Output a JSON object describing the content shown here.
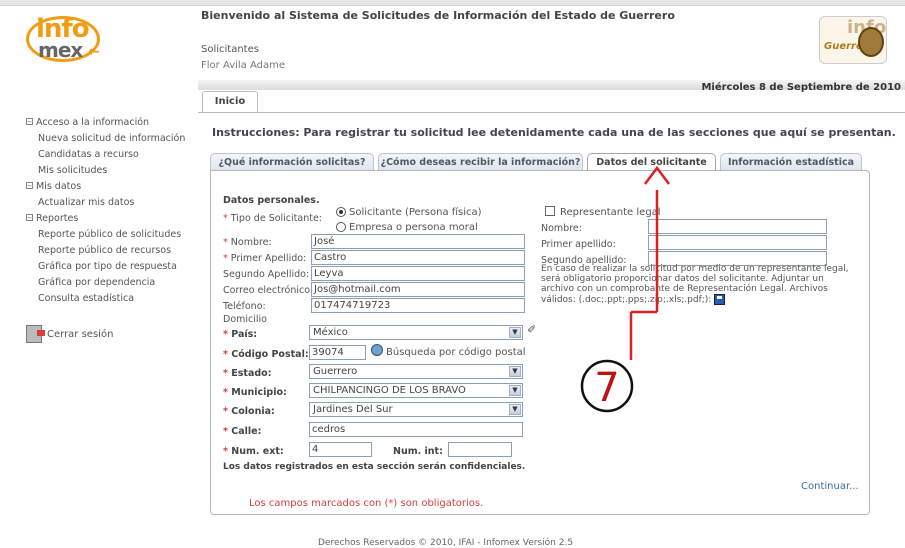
{
  "header": {
    "logo_left_text": [
      "info",
      "mex"
    ],
    "title": "Bienvenido al Sistema de Solicitudes de Información del Estado de Guerrero",
    "role": "Solicitantes",
    "user": "Flor Avila Adame",
    "logo_right_text": [
      "info",
      "Guerrero"
    ],
    "date": "Miércoles 8 de Septiembre de 2010"
  },
  "tabs_top": {
    "inicio": "Inicio"
  },
  "sidebar": {
    "items": [
      {
        "label": "Acceso a la información",
        "type": "section"
      },
      {
        "label": "Nueva solicitud de información",
        "type": "item"
      },
      {
        "label": "Candidatas a recurso",
        "type": "item"
      },
      {
        "label": "Mis solicitudes",
        "type": "item"
      },
      {
        "label": "Mis datos",
        "type": "section"
      },
      {
        "label": "Actualizar mis datos",
        "type": "item"
      },
      {
        "label": "Reportes",
        "type": "section"
      },
      {
        "label": "Reporte público de solicitudes",
        "type": "item"
      },
      {
        "label": "Reporte público de recursos",
        "type": "item"
      },
      {
        "label": "Gráfica por tipo de respuesta",
        "type": "item"
      },
      {
        "label": "Gráfica por dependencia",
        "type": "item"
      },
      {
        "label": "Consulta estadística",
        "type": "item"
      }
    ],
    "logout": "Cerrar sesión"
  },
  "main": {
    "instructions": "Instrucciones: Para registrar tu solicitud lee detenidamente cada una de las secciones que aquí se presentan.",
    "tabs": [
      {
        "label": "¿Qué información solicitas?",
        "active": false
      },
      {
        "label": "¿Cómo deseas recibir la información?",
        "active": false
      },
      {
        "label": "Datos del solicitante",
        "active": true
      },
      {
        "label": "Información estadística",
        "active": false
      }
    ]
  },
  "form": {
    "section_title": "Datos personales.",
    "tipo_label": "Tipo de Solicitante:",
    "radio_fisica": "Solicitante (Persona física)",
    "radio_moral": "Empresa o persona moral",
    "nombre_label": "Nombre:",
    "nombre_value": "José",
    "primer_apellido_label": "Primer Apellido:",
    "primer_apellido_value": "Castro",
    "segundo_apellido_label": "Segundo Apellido:",
    "segundo_apellido_value": "Leyva",
    "correo_label": "Correo electrónico:",
    "correo_value": "Jos@hotmail.com",
    "telefono_label": "Teléfono:",
    "telefono_value": "017474719723",
    "domicilio_label": "Domicilio",
    "pais_label": "País:",
    "pais_value": "México",
    "cp_label": "Código Postal:",
    "cp_value": "39074",
    "cp_search": "Búsqueda por código postal",
    "estado_label": "Estado:",
    "estado_value": "Guerrero",
    "municipio_label": "Municipio:",
    "municipio_value": "CHILPANCINGO DE LOS BRAVO",
    "colonia_label": "Colonia:",
    "colonia_value": "Jardines Del Sur",
    "calle_label": "Calle:",
    "calle_value": "cedros",
    "num_ext_label": "Num. ext:",
    "num_ext_value": "4",
    "num_int_label": "Num. int:",
    "num_int_value": "",
    "confidential": "Los datos registrados en esta sección serán confidenciales.",
    "required_note": "Los campos marcados con (*) son obligatorios.",
    "continue": "Continuar..."
  },
  "representante": {
    "checkbox_label": "Representante legal",
    "nombre_label": "Nombre:",
    "primer_apellido_label": "Primer apellido:",
    "segundo_apellido_label": "Segundo apellido:",
    "note": "En caso de realizar la solicitud por medio de un representante legal, será obligatorio proporcionar datos del solicitante. Adjuntar un archivo con un comprobante de Representación Legal. Archivos válidos: (.doc;.ppt;.pps;.zip;.xls;.pdf;):"
  },
  "annotation": {
    "number": "7",
    "color": "#e02020"
  },
  "footer": "Derechos Reservados © 2010, IFAI - Infomex Versión 2.5"
}
